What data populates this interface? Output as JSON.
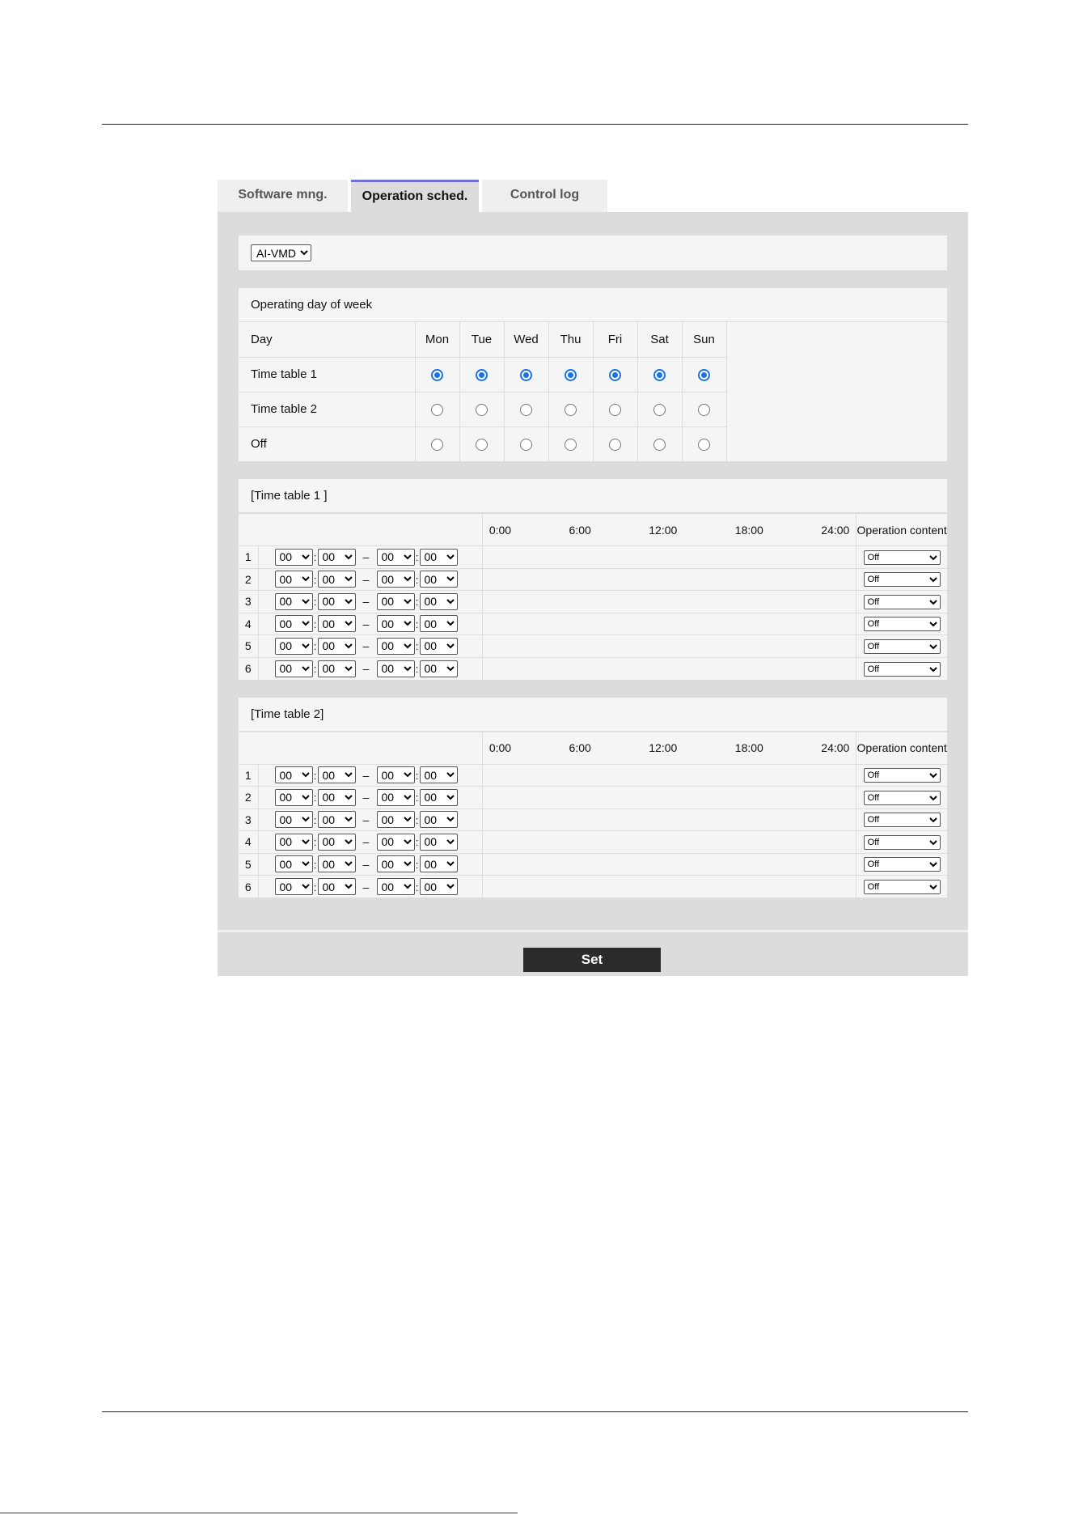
{
  "tabs": [
    {
      "label": "Software mng."
    },
    {
      "label": "Operation sched."
    },
    {
      "label": "Control log"
    }
  ],
  "mode_select": {
    "value": "AI-VMD"
  },
  "week": {
    "title": "Operating day of week",
    "day_label": "Day",
    "days": [
      "Mon",
      "Tue",
      "Wed",
      "Thu",
      "Fri",
      "Sat",
      "Sun"
    ],
    "rows": [
      {
        "label": "Time table 1",
        "selected": true
      },
      {
        "label": "Time table 2",
        "selected": false
      },
      {
        "label": "Off",
        "selected": false
      }
    ]
  },
  "timetables": [
    {
      "title": "[Time table 1 ]",
      "scale": [
        "0:00",
        "6:00",
        "12:00",
        "18:00",
        "24:00"
      ],
      "op_header": "Operation content",
      "rows": [
        {
          "num": "1",
          "start_h": "00",
          "start_m": "00",
          "end_h": "00",
          "end_m": "00",
          "op": "Off"
        },
        {
          "num": "2",
          "start_h": "00",
          "start_m": "00",
          "end_h": "00",
          "end_m": "00",
          "op": "Off"
        },
        {
          "num": "3",
          "start_h": "00",
          "start_m": "00",
          "end_h": "00",
          "end_m": "00",
          "op": "Off"
        },
        {
          "num": "4",
          "start_h": "00",
          "start_m": "00",
          "end_h": "00",
          "end_m": "00",
          "op": "Off"
        },
        {
          "num": "5",
          "start_h": "00",
          "start_m": "00",
          "end_h": "00",
          "end_m": "00",
          "op": "Off"
        },
        {
          "num": "6",
          "start_h": "00",
          "start_m": "00",
          "end_h": "00",
          "end_m": "00",
          "op": "Off"
        }
      ]
    },
    {
      "title": "[Time table 2]",
      "scale": [
        "0:00",
        "6:00",
        "12:00",
        "18:00",
        "24:00"
      ],
      "op_header": "Operation content",
      "rows": [
        {
          "num": "1",
          "start_h": "00",
          "start_m": "00",
          "end_h": "00",
          "end_m": "00",
          "op": "Off"
        },
        {
          "num": "2",
          "start_h": "00",
          "start_m": "00",
          "end_h": "00",
          "end_m": "00",
          "op": "Off"
        },
        {
          "num": "3",
          "start_h": "00",
          "start_m": "00",
          "end_h": "00",
          "end_m": "00",
          "op": "Off"
        },
        {
          "num": "4",
          "start_h": "00",
          "start_m": "00",
          "end_h": "00",
          "end_m": "00",
          "op": "Off"
        },
        {
          "num": "5",
          "start_h": "00",
          "start_m": "00",
          "end_h": "00",
          "end_m": "00",
          "op": "Off"
        },
        {
          "num": "6",
          "start_h": "00",
          "start_m": "00",
          "end_h": "00",
          "end_m": "00",
          "op": "Off"
        }
      ]
    }
  ],
  "time_separator": ":",
  "range_separator": "–",
  "set_button": {
    "label": "Set"
  },
  "colors": {
    "accent": "#1a73e8",
    "active_tab_border": "#7272d9",
    "panel_bg": "#dcdcdc",
    "button_bg": "#2b2b2b"
  }
}
